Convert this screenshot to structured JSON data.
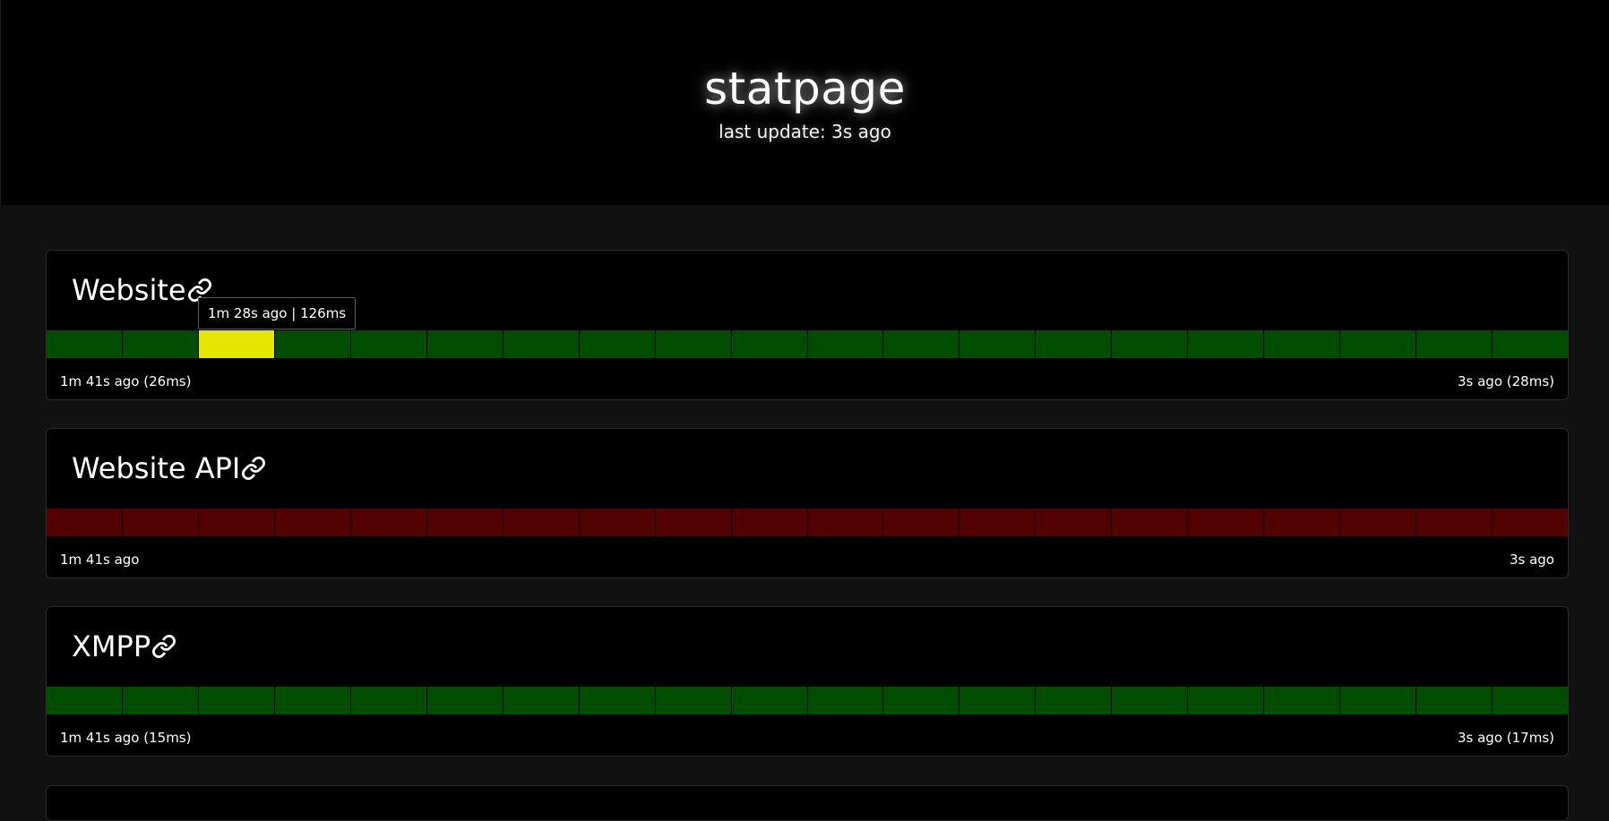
{
  "header": {
    "title": "statpage",
    "last_update": "last update: 3s ago"
  },
  "colors": {
    "ok": "#004d00",
    "warn": "#e6e600",
    "down": "#520000",
    "header_bg": "#000000",
    "page_bg": "#111111"
  },
  "services": [
    {
      "name": "Website",
      "link_icon": "link-icon",
      "segments": [
        "ok",
        "ok",
        "warn",
        "ok",
        "ok",
        "ok",
        "ok",
        "ok",
        "ok",
        "ok",
        "ok",
        "ok",
        "ok",
        "ok",
        "ok",
        "ok",
        "ok",
        "ok",
        "ok",
        "ok"
      ],
      "oldest": "1m 41s ago (26ms)",
      "newest": "3s ago (28ms)"
    },
    {
      "name": "Website API",
      "link_icon": "link-icon",
      "segments": [
        "down",
        "down",
        "down",
        "down",
        "down",
        "down",
        "down",
        "down",
        "down",
        "down",
        "down",
        "down",
        "down",
        "down",
        "down",
        "down",
        "down",
        "down",
        "down",
        "down"
      ],
      "oldest": "1m 41s ago",
      "newest": "3s ago"
    },
    {
      "name": "XMPP",
      "link_icon": "link-icon",
      "segments": [
        "ok",
        "ok",
        "ok",
        "ok",
        "ok",
        "ok",
        "ok",
        "ok",
        "ok",
        "ok",
        "ok",
        "ok",
        "ok",
        "ok",
        "ok",
        "ok",
        "ok",
        "ok",
        "ok",
        "ok"
      ],
      "oldest": "1m 41s ago (15ms)",
      "newest": "3s ago (17ms)"
    }
  ],
  "tooltip": {
    "text": "1m 28s ago | 126ms"
  }
}
